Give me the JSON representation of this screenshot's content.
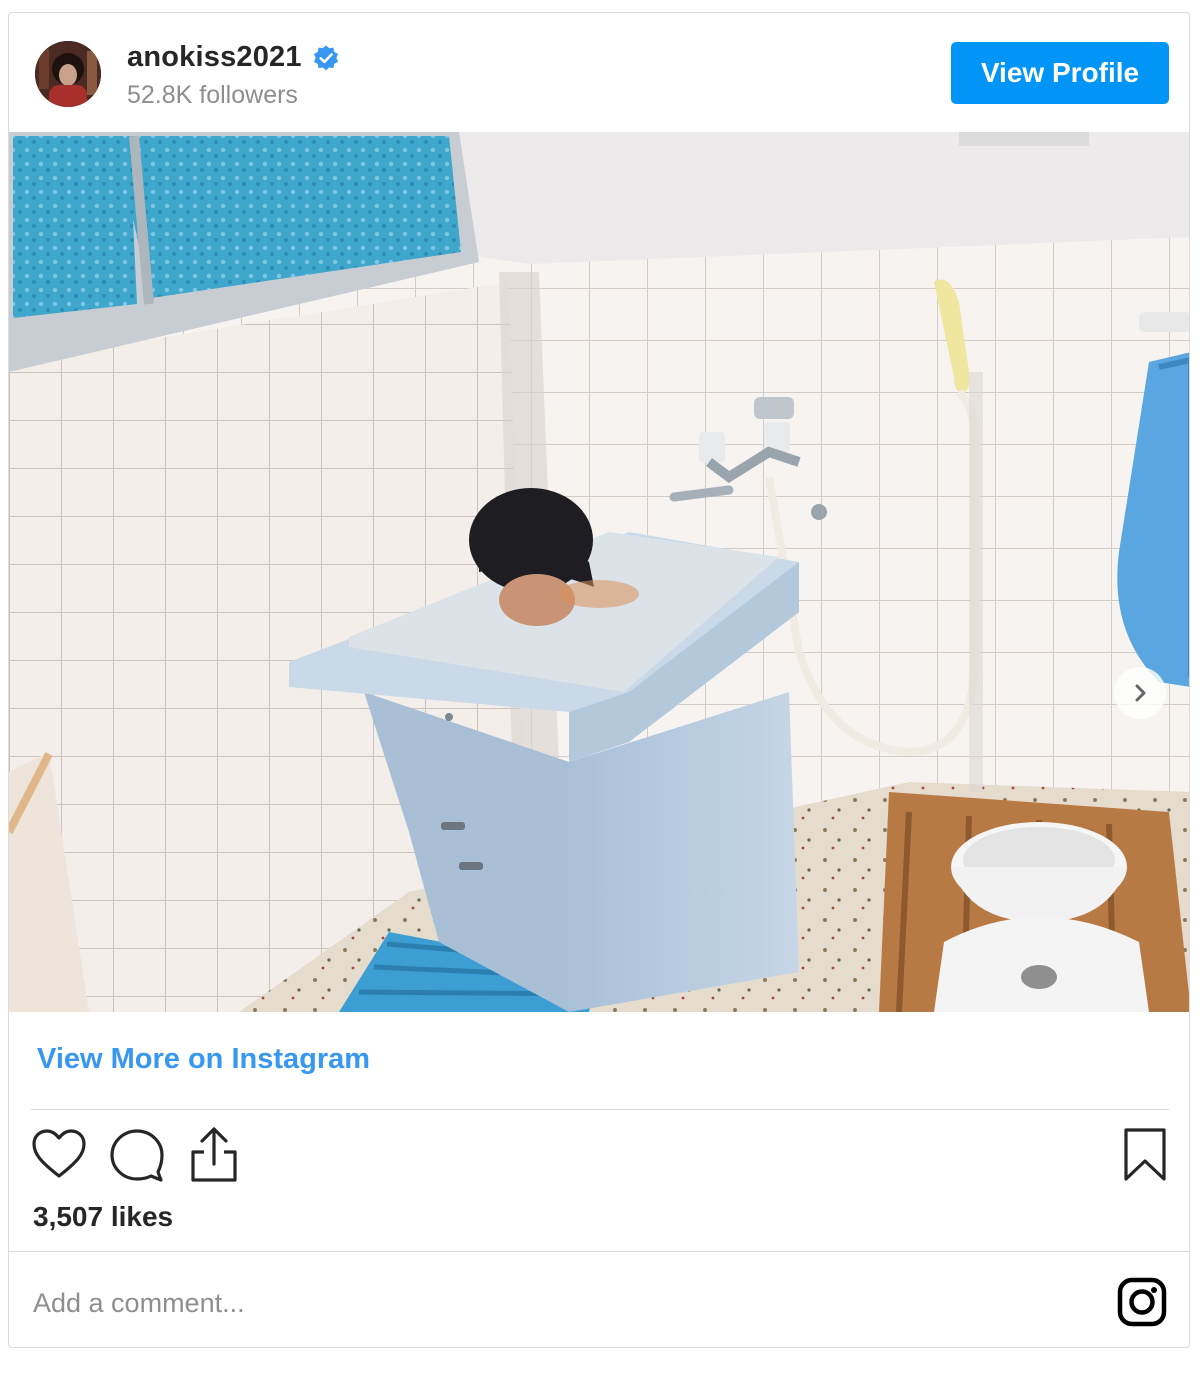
{
  "header": {
    "username": "anokiss2021",
    "followers": "52.8K followers",
    "view_profile_label": "View Profile",
    "verified_icon": "verified-badge-icon"
  },
  "post": {
    "image_alt": "Person submerged up to the head in a small blue bathtub in a tiled bathroom",
    "carousel": {
      "total_slides": 2,
      "active_slide": 1
    }
  },
  "view_more_label": "View More on Instagram",
  "actions": {
    "icons": [
      "heart-icon",
      "comment-icon",
      "share-icon",
      "bookmark-icon"
    ]
  },
  "likes": "3,507 likes",
  "comment": {
    "placeholder": "Add a comment..."
  },
  "colors": {
    "accent": "#0095f6",
    "link": "#3897f0",
    "muted": "#8e8e8e",
    "border": "#dbdbdb"
  }
}
